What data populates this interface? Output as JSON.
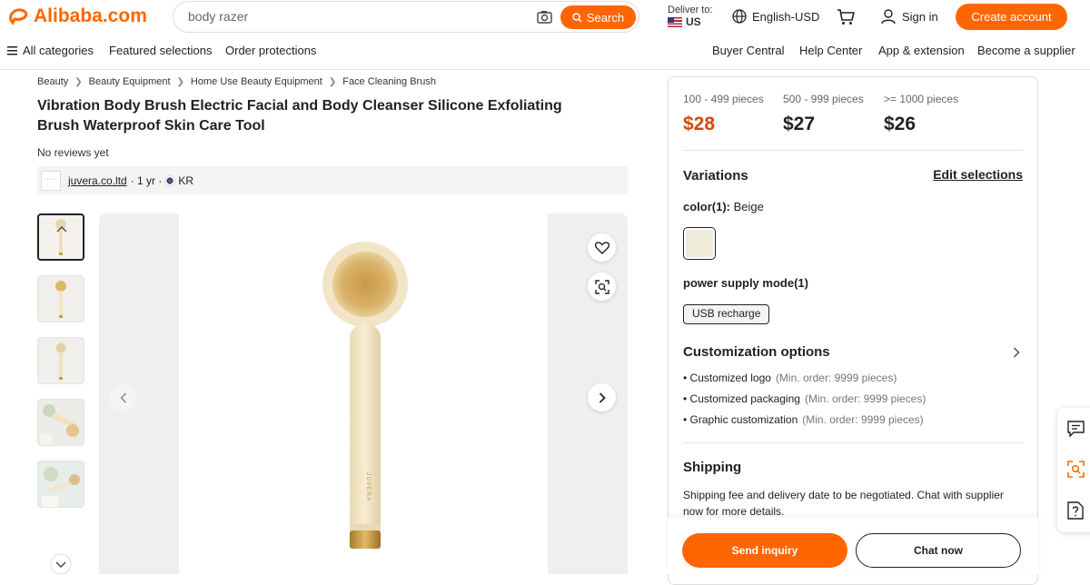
{
  "header": {
    "logo_text": "Alibaba.com",
    "search_value": "body razer",
    "search_button": "Search",
    "deliver_label": "Deliver to:",
    "deliver_country": "US",
    "language": "English-USD",
    "sign_in": "Sign in",
    "create_account": "Create account",
    "brand_color": "#ff6600"
  },
  "nav": {
    "all_categories": "All categories",
    "featured": "Featured selections",
    "protections": "Order protections",
    "buyer_central": "Buyer Central",
    "help_center": "Help Center",
    "app": "App & extension",
    "supplier": "Become a supplier"
  },
  "breadcrumb": [
    "Beauty",
    "Beauty Equipment",
    "Home Use Beauty Equipment",
    "Face Cleaning Brush"
  ],
  "product": {
    "title": "Vibration Body Brush Electric Facial and Body Cleanser Silicone Exfoliating Brush Waterproof Skin Care Tool",
    "reviews": "No reviews yet",
    "supplier_name": "juvera.co.ltd",
    "supplier_years": "· 1 yr ·",
    "supplier_country": "KR",
    "brush_text": "JUVERA"
  },
  "pricing": [
    {
      "range": "100 - 499 pieces",
      "price": "$28",
      "color": "#d04a02"
    },
    {
      "range": "500 - 999 pieces",
      "price": "$27",
      "color": "#222222"
    },
    {
      "range": ">= 1000 pieces",
      "price": "$26",
      "color": "#222222"
    }
  ],
  "variations": {
    "title": "Variations",
    "edit": "Edit selections",
    "color_label": "color(1):",
    "color_value": "Beige",
    "power_label": "power supply mode(1)",
    "power_value": "USB recharge"
  },
  "customization": {
    "title": "Customization options",
    "items": [
      {
        "name": "Customized logo",
        "min": "(Min. order: 9999 pieces)"
      },
      {
        "name": "Customized packaging",
        "min": "(Min. order: 9999 pieces)"
      },
      {
        "name": "Graphic customization",
        "min": "(Min. order: 9999 pieces)"
      }
    ]
  },
  "shipping": {
    "title": "Shipping",
    "text": "Shipping fee and delivery date to be negotiated. Chat with supplier now for more details."
  },
  "actions": {
    "send_inquiry": "Send inquiry",
    "chat_now": "Chat now"
  }
}
